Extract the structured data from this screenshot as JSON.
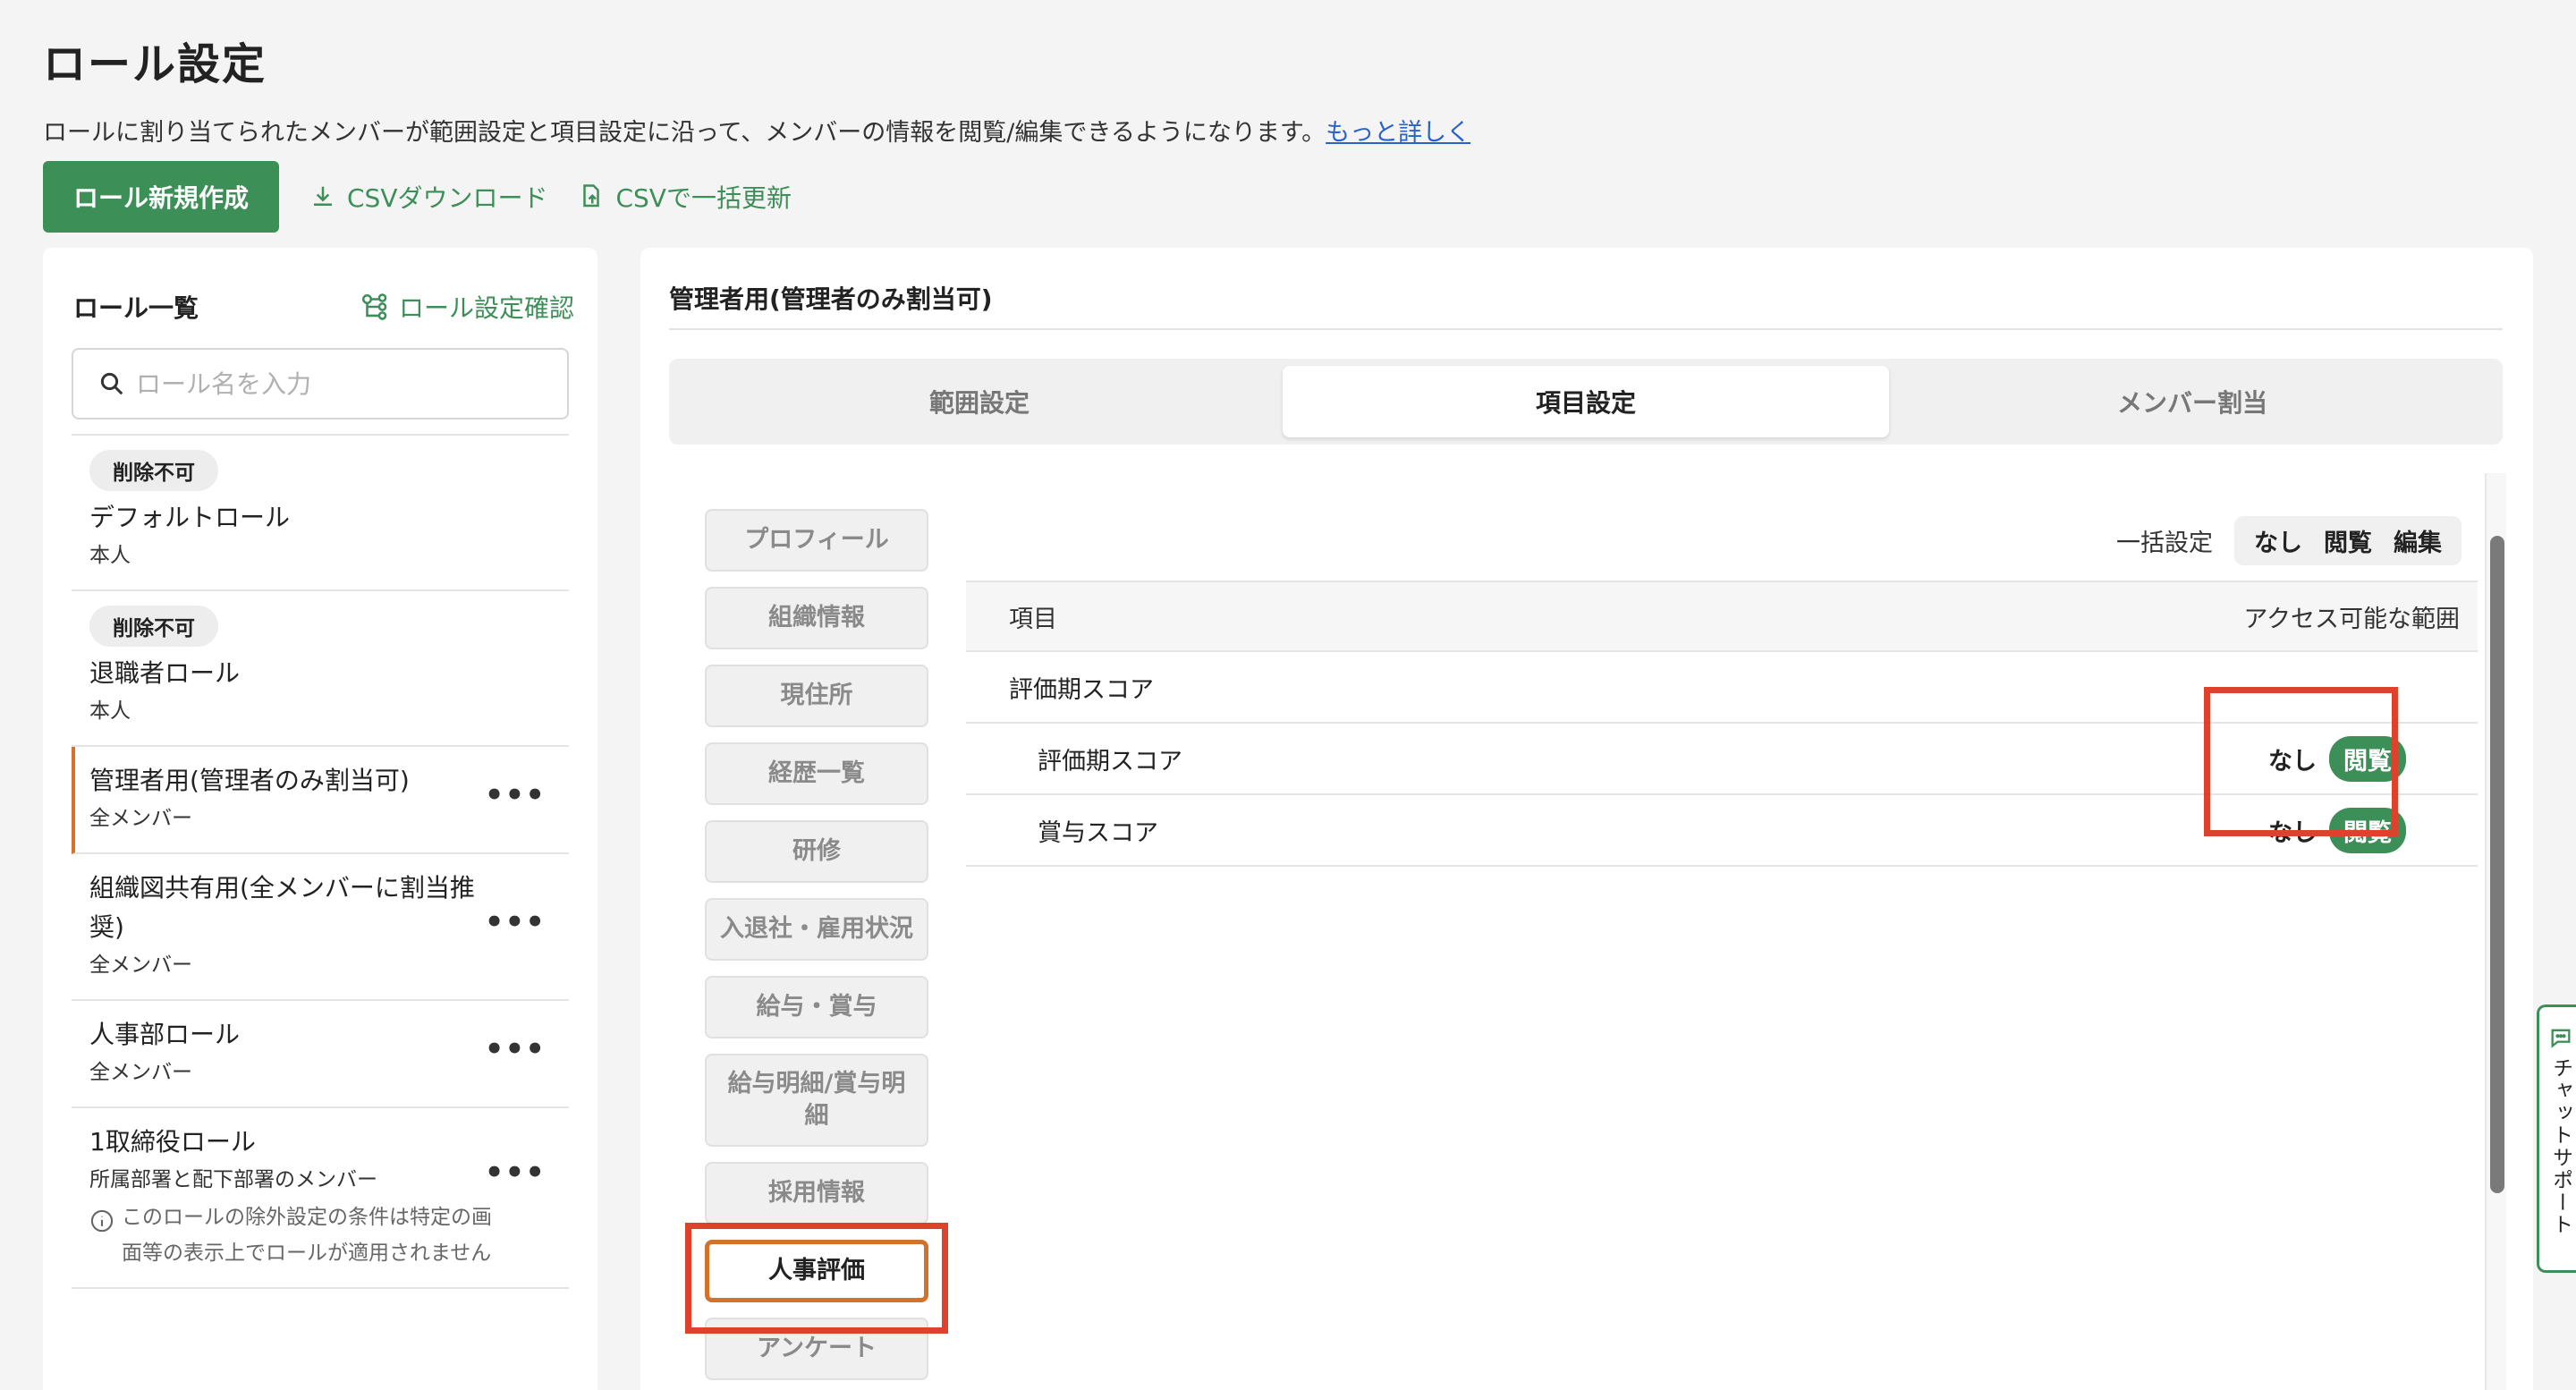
{
  "page": {
    "title": "ロール設定",
    "description": "ロールに割り当てられたメンバーが範囲設定と項目設定に沿って、メンバーの情報を閲覧/編集できるようになります。",
    "more_link": "もっと詳しく"
  },
  "toolbar": {
    "create_label": "ロール新規作成",
    "csv_download_label": "CSVダウンロード",
    "csv_update_label": "CSVで一括更新"
  },
  "role_list": {
    "title": "ロール一覧",
    "confirm_label": "ロール設定確認",
    "search_placeholder": "ロール名を入力",
    "items": [
      {
        "badge": "削除不可",
        "name": "デフォルトロール",
        "scope": "本人"
      },
      {
        "badge": "削除不可",
        "name": "退職者ロール",
        "scope": "本人"
      },
      {
        "name": "管理者用(管理者のみ割当可)",
        "scope": "全メンバー",
        "more": "•••"
      },
      {
        "name": "組織図共有用(全メンバーに割当推奨)",
        "scope": "全メンバー",
        "more": "•••"
      },
      {
        "name": "人事部ロール",
        "scope": "全メンバー",
        "more": "•••"
      },
      {
        "name": "1取締役ロール",
        "scope": "所属部署と配下部署のメンバー",
        "note": "このロールの除外設定の条件は特定の画面等の表示上でロールが適用されません",
        "more": "•••"
      }
    ]
  },
  "detail": {
    "title": "管理者用(管理者のみ割当可)",
    "tabs": [
      "範囲設定",
      "項目設定",
      "メンバー割当"
    ],
    "categories": [
      "プロフィール",
      "組織情報",
      "現住所",
      "経歴一覧",
      "研修",
      "入退社・雇用状況",
      "給与・賞与",
      "給与明細/賞与明細",
      "採用情報",
      "人事評価",
      "アンケート"
    ],
    "bulk": {
      "label": "一括設定",
      "none": "なし",
      "view": "閲覧",
      "edit": "編集"
    },
    "table": {
      "header_item": "項目",
      "header_access": "アクセス可能な範囲",
      "group": "評価期スコア",
      "rows": [
        {
          "label": "評価期スコア",
          "none": "なし",
          "view": "閲覧"
        },
        {
          "label": "賞与スコア",
          "none": "なし",
          "view": "閲覧"
        }
      ]
    }
  },
  "chat_support": {
    "label": "チャットサポート"
  }
}
